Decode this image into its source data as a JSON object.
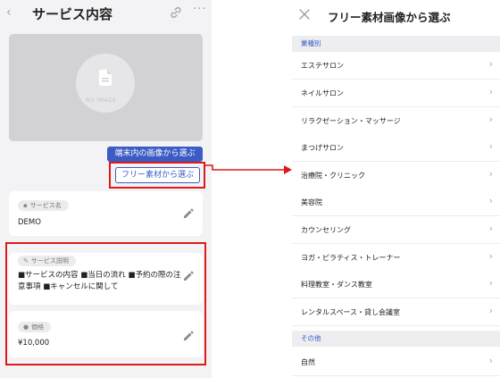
{
  "left": {
    "header": {
      "back_icon": "chevron-left-icon",
      "title": "サービス内容",
      "link_icon": "link-icon",
      "more_icon": "more-dots-icon",
      "back_glyph": "‹",
      "more_glyph": "···"
    },
    "image_placeholder": {
      "text": "NO IMAGE",
      "icon": "document-icon"
    },
    "buttons": {
      "device_label": "端末内の画像から選ぶ",
      "free_label": "フリー素材から選ぶ"
    },
    "fields": [
      {
        "chip_label": "サービス名",
        "chip_icon": "document-icon",
        "chip_glyph": "▪",
        "value": "DEMO"
      },
      {
        "chip_label": "サービス説明",
        "chip_icon": "pencil-icon",
        "chip_glyph": "✎",
        "value": "■サービスの内容 ■当日の流れ ■予約の際の注意事項 ■キャンセルに関して"
      },
      {
        "chip_label": "価格",
        "chip_icon": "yen-coin-icon",
        "chip_glyph": "●",
        "value": "¥10,000"
      }
    ]
  },
  "right": {
    "header": {
      "close_icon": "close-icon",
      "title": "フリー素材画像から選ぶ"
    },
    "section1": {
      "label": "業種別"
    },
    "items": [
      "エステサロン",
      "ネイルサロン",
      "リラクゼーション・マッサージ",
      "まつげサロン",
      "治療院・クリニック",
      "美容院",
      "カウンセリング",
      "ヨガ・ピラティス・トレーナー",
      "料理教室・ダンス教室",
      "レンタルスペース・貸し会議室"
    ],
    "section2": {
      "label": "その他"
    },
    "other_items": [
      "自然"
    ],
    "chevron_glyph": "›"
  },
  "colors": {
    "accent": "#3b5cc4",
    "highlight": "#e01818",
    "bg": "#f3f3f5"
  }
}
